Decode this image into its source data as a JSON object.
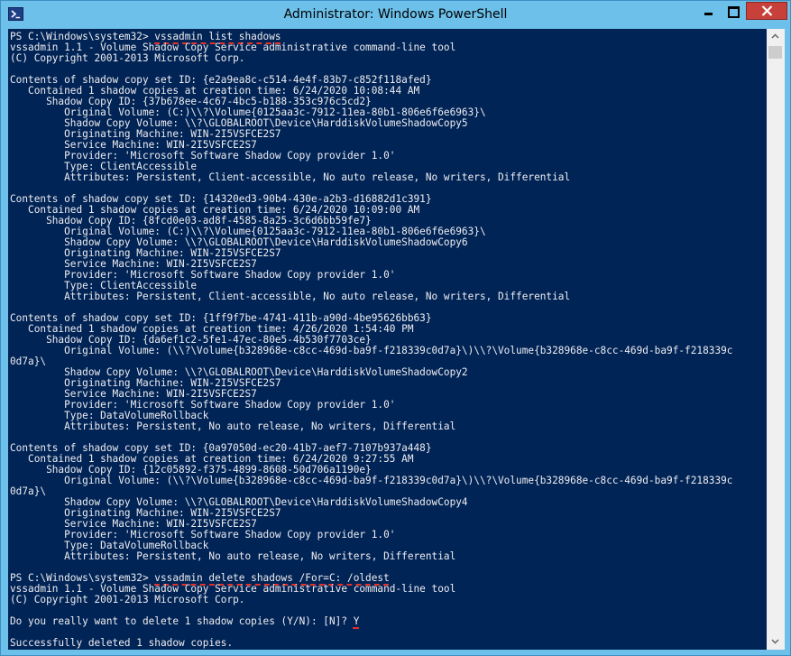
{
  "window": {
    "title": "Administrator: Windows PowerShell",
    "controls": {
      "minimize": "minimize-icon",
      "maximize": "maximize-icon",
      "close": "close-icon"
    },
    "colors": {
      "titlebar": "#6cc0ea",
      "console_bg": "#012456",
      "console_fg": "#eeedf0",
      "annotation": "#e0312b",
      "close_button": "#c7403a"
    }
  },
  "console": {
    "lines": [
      {
        "text": "PS C:\\Windows\\system32> ",
        "ul": "vssadmin list shadows"
      },
      {
        "text": "vssadmin 1.1 - Volume Shadow Copy Service administrative command-line tool"
      },
      {
        "text": "(C) Copyright 2001-2013 Microsoft Corp."
      },
      {
        "text": ""
      },
      {
        "text": "Contents of shadow copy set ID: {e2a9ea8c-c514-4e4f-83b7-c852f118afed}"
      },
      {
        "text": "   Contained 1 shadow copies at creation time: 6/24/2020 10:08:44 AM"
      },
      {
        "text": "      Shadow Copy ID: {37b678ee-4c67-4bc5-b188-353c976c5cd2}"
      },
      {
        "text": "         Original Volume: (C:)\\\\?\\Volume{0125aa3c-7912-11ea-80b1-806e6f6e6963}\\"
      },
      {
        "text": "         Shadow Copy Volume: \\\\?\\GLOBALROOT\\Device\\HarddiskVolumeShadowCopy5"
      },
      {
        "text": "         Originating Machine: WIN-2I5VSFCE2S7"
      },
      {
        "text": "         Service Machine: WIN-2I5VSFCE2S7"
      },
      {
        "text": "         Provider: 'Microsoft Software Shadow Copy provider 1.0'"
      },
      {
        "text": "         Type: ClientAccessible"
      },
      {
        "text": "         Attributes: Persistent, Client-accessible, No auto release, No writers, Differential"
      },
      {
        "text": ""
      },
      {
        "text": "Contents of shadow copy set ID: {14320ed3-90b4-430e-a2b3-d16882d1c391}"
      },
      {
        "text": "   Contained 1 shadow copies at creation time: 6/24/2020 10:09:00 AM"
      },
      {
        "text": "      Shadow Copy ID: {8fcd0e03-ad8f-4585-8a25-3c6d6bb59fe7}"
      },
      {
        "text": "         Original Volume: (C:)\\\\?\\Volume{0125aa3c-7912-11ea-80b1-806e6f6e6963}\\"
      },
      {
        "text": "         Shadow Copy Volume: \\\\?\\GLOBALROOT\\Device\\HarddiskVolumeShadowCopy6"
      },
      {
        "text": "         Originating Machine: WIN-2I5VSFCE2S7"
      },
      {
        "text": "         Service Machine: WIN-2I5VSFCE2S7"
      },
      {
        "text": "         Provider: 'Microsoft Software Shadow Copy provider 1.0'"
      },
      {
        "text": "         Type: ClientAccessible"
      },
      {
        "text": "         Attributes: Persistent, Client-accessible, No auto release, No writers, Differential"
      },
      {
        "text": ""
      },
      {
        "text": "Contents of shadow copy set ID: {1ff9f7be-4741-411b-a90d-4be95626bb63}"
      },
      {
        "text": "   Contained 1 shadow copies at creation time: 4/26/2020 1:54:40 PM"
      },
      {
        "text": "      Shadow Copy ID: {da6ef1c2-5fe1-47ec-80e5-4b530f7703ce}"
      },
      {
        "text": "         Original Volume: (\\\\?\\Volume{b328968e-c8cc-469d-ba9f-f218339c0d7a}\\)\\\\?\\Volume{b328968e-c8cc-469d-ba9f-f218339c"
      },
      {
        "text": "0d7a}\\"
      },
      {
        "text": "         Shadow Copy Volume: \\\\?\\GLOBALROOT\\Device\\HarddiskVolumeShadowCopy2"
      },
      {
        "text": "         Originating Machine: WIN-2I5VSFCE2S7"
      },
      {
        "text": "         Service Machine: WIN-2I5VSFCE2S7"
      },
      {
        "text": "         Provider: 'Microsoft Software Shadow Copy provider 1.0'"
      },
      {
        "text": "         Type: DataVolumeRollback"
      },
      {
        "text": "         Attributes: Persistent, No auto release, No writers, Differential"
      },
      {
        "text": ""
      },
      {
        "text": "Contents of shadow copy set ID: {0a97050d-ec20-41b7-aef7-7107b937a448}"
      },
      {
        "text": "   Contained 1 shadow copies at creation time: 6/24/2020 9:27:55 AM"
      },
      {
        "text": "      Shadow Copy ID: {12c05892-f375-4899-8608-50d706a1190e}"
      },
      {
        "text": "         Original Volume: (\\\\?\\Volume{b328968e-c8cc-469d-ba9f-f218339c0d7a}\\)\\\\?\\Volume{b328968e-c8cc-469d-ba9f-f218339c"
      },
      {
        "text": "0d7a}\\"
      },
      {
        "text": "         Shadow Copy Volume: \\\\?\\GLOBALROOT\\Device\\HarddiskVolumeShadowCopy4"
      },
      {
        "text": "         Originating Machine: WIN-2I5VSFCE2S7"
      },
      {
        "text": "         Service Machine: WIN-2I5VSFCE2S7"
      },
      {
        "text": "         Provider: 'Microsoft Software Shadow Copy provider 1.0'"
      },
      {
        "text": "         Type: DataVolumeRollback"
      },
      {
        "text": "         Attributes: Persistent, No auto release, No writers, Differential"
      },
      {
        "text": ""
      },
      {
        "text": "PS C:\\Windows\\system32> ",
        "ul": "vssadmin delete shadows /For=C: /oldest"
      },
      {
        "text": "vssadmin 1.1 - Volume Shadow Copy Service administrative command-line tool"
      },
      {
        "text": "(C) Copyright 2001-2013 Microsoft Corp."
      },
      {
        "text": ""
      },
      {
        "text": "Do you really want to delete 1 shadow copies (Y/N): [N]? ",
        "ul": "Y"
      },
      {
        "text": ""
      },
      {
        "text": "Successfully deleted 1 shadow copies."
      }
    ]
  }
}
